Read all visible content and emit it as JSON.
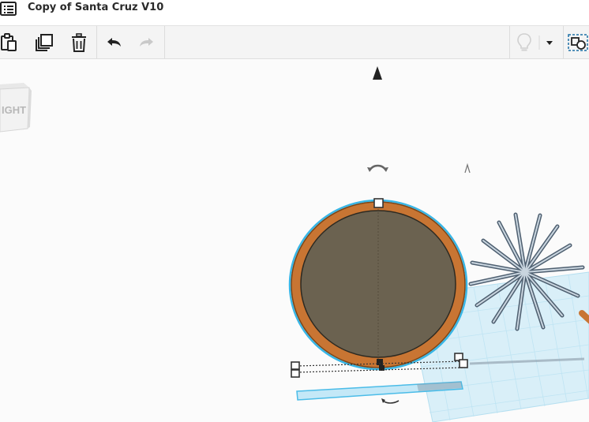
{
  "window": {
    "title": "Copy of Santa Cruz V10",
    "menu_icon": "list-menu-icon"
  },
  "toolbar": {
    "buttons": [
      {
        "name": "paste-icon",
        "label": "Paste"
      },
      {
        "name": "duplicate-icon",
        "label": "Duplicate"
      },
      {
        "name": "trash-icon",
        "label": "Delete"
      },
      {
        "name": "undo-icon",
        "label": "Undo"
      },
      {
        "name": "redo-icon",
        "label": "Redo"
      }
    ],
    "right_buttons": [
      {
        "name": "lightbulb-icon"
      },
      {
        "name": "dropdown-caret-icon"
      },
      {
        "name": "shape-group-icon"
      }
    ]
  },
  "view_cube": {
    "face_label": "IGHT"
  },
  "colors": {
    "ring": "#c87533",
    "ring_dark": "#9c5a24",
    "face": "#6b6250",
    "selection_outline": "#38b6e6",
    "workplane": "#cfeaf5",
    "workplane_line": "#a7d8ec",
    "spikes": "#6f7f90"
  }
}
